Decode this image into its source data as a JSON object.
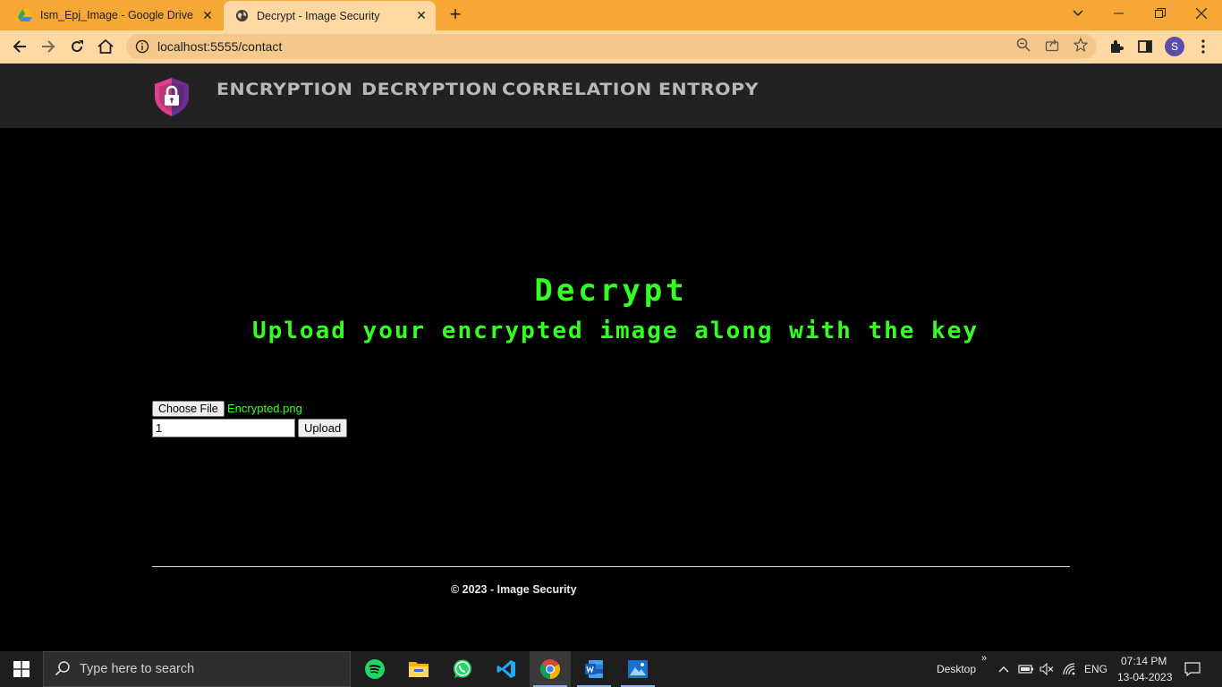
{
  "browser": {
    "tabs": [
      {
        "title": "Ism_Epj_Image - Google Drive",
        "active": false
      },
      {
        "title": "Decrypt - Image Security",
        "active": true
      }
    ],
    "url": "localhost:5555/contact",
    "profile_initial": "S"
  },
  "site": {
    "nav": [
      "ENCRYPTION",
      "DECRYPTION",
      "CORRELATION",
      "ENTROPY"
    ],
    "title": "Decrypt",
    "subtitle": "Upload your encrypted image along with the key",
    "form": {
      "choose_file_label": "Choose File",
      "file_name": "Encrypted.png",
      "key_value": "1",
      "upload_label": "Upload"
    },
    "footer": "© 2023 - Image Security",
    "colors": {
      "accent": "#33ff22",
      "header_bg": "#222222",
      "nav_text": "#b8b8b8"
    }
  },
  "taskbar": {
    "search_placeholder": "Type here to search",
    "apps": [
      "spotify-icon",
      "file-explorer-icon",
      "whatsapp-icon",
      "vscode-icon",
      "chrome-icon",
      "word-icon",
      "photos-icon"
    ],
    "desktop_label": "Desktop",
    "language": "ENG",
    "time": "07:14 PM",
    "date": "13-04-2023"
  }
}
